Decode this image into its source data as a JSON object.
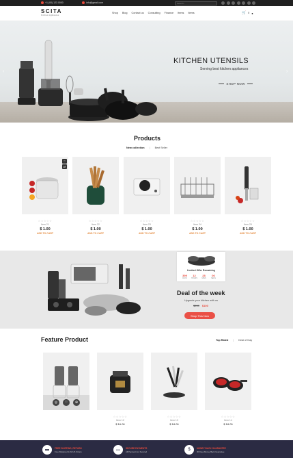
{
  "topbar": {
    "phone": "+1 (00) 123 0000",
    "email": "info@gmail.com",
    "search_placeholder": "Search..."
  },
  "header": {
    "logo": "SCITA",
    "logo_sub": "Kitchen Appliances",
    "nav": [
      "Shop",
      "Blog",
      "Contact us",
      "Consulting",
      "Finance",
      "Items",
      "Items"
    ],
    "cart_count": "0"
  },
  "hero": {
    "title": "KITCHEN UTENSILS",
    "subtitle": "Serving best kitchen appliances",
    "button": "SHOP NOW",
    "prev": "‹",
    "next": "›"
  },
  "products": {
    "title": "Products",
    "tabs": [
      "New collection",
      "Best Seller"
    ],
    "items": [
      {
        "name": "Item 21",
        "price": "$ 1.00",
        "stars": "☆☆☆☆☆",
        "add": "ADD TO CART"
      },
      {
        "name": "Item 22",
        "price": "$ 1.00",
        "stars": "☆☆☆☆☆",
        "add": "ADD TO CART"
      },
      {
        "name": "Item 23",
        "price": "$ 1.00",
        "stars": "☆☆☆☆☆",
        "add": "ADD TO CART"
      },
      {
        "name": "Item 24",
        "price": "$ 1.00",
        "stars": "☆☆☆☆☆",
        "add": "ADD TO CART"
      },
      {
        "name": "Item 25",
        "price": "$ 1.00",
        "stars": "☆☆☆☆☆",
        "add": "ADD TO CART"
      }
    ]
  },
  "deal": {
    "offer_label": "Limited Offer Remaining",
    "countdown": [
      {
        "n": "399",
        "l": "DAYS"
      },
      {
        "n": "12",
        "l": "HOURS"
      },
      {
        "n": "28",
        "l": "MINS"
      },
      {
        "n": "06",
        "l": "SECS"
      }
    ],
    "title": "Deal of the week",
    "subtitle": "Upgrade your kitchen with us",
    "old_price": "$200",
    "new_price": "$100",
    "button": "Shop This Now"
  },
  "feature": {
    "title": "Feature Product",
    "tabs": [
      "Top Rated",
      "Deal of Day"
    ],
    "items": [
      {
        "name": "",
        "price": "",
        "stars": ""
      },
      {
        "name": "Item 12",
        "price": "$ 16.00",
        "stars": "☆☆☆☆☆"
      },
      {
        "name": "Item 13",
        "price": "$ 18.00",
        "stars": "☆☆☆☆☆"
      },
      {
        "name": "Item 14",
        "price": "$ 18.00",
        "stars": "☆☆☆☆☆"
      }
    ]
  },
  "footer": {
    "features": [
      {
        "title": "FREE SHIPPING, RETURN",
        "text": "Free Shipping On All US Orders"
      },
      {
        "title": "SECURE PAYMENTS",
        "text": "All Payment Are Secured"
      },
      {
        "title": "MONEY BACK GUARANTEE",
        "text": "30 Days Money Back Guarantee"
      }
    ]
  },
  "colors": {
    "accent": "#e94b3c",
    "add_to_cart": "#e4893c",
    "footer_bg": "#2b2b43",
    "topbar_bg": "#202020"
  }
}
